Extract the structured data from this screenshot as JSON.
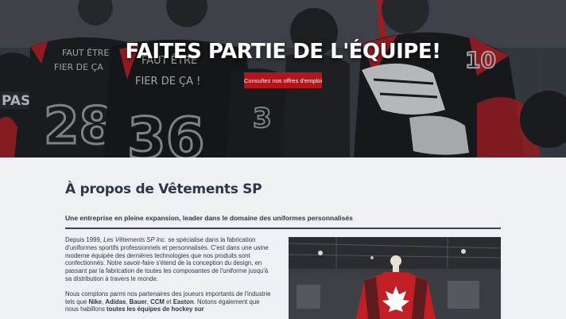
{
  "hero": {
    "title": "FAITES PARTIE DE L'ÉQUIPE!",
    "button_label": "Consultez nos offres d'emploi",
    "jersey_texts": [
      "FAUT ÊTRE",
      "FIER DE ÇA",
      "FAUT ÊTRE",
      "FIER DE ÇA !"
    ],
    "jersey_numbers": [
      "28",
      "36",
      "3",
      "10"
    ]
  },
  "about": {
    "title": "À propos de Vêtements SP",
    "subtitle": "Une entreprise en pleine expansion, leader dans le domaine des uniformes personnalisés",
    "p1_before_em": "Depuis 1999, ",
    "p1_em": "Les Vêtements SP Inc.",
    "p1_after_em": " se spécialise dans la fabrication d'uniformes sportifs professionnels et personnalisés. C'est dans une usine moderne équipée des dernières technologies que nos produits sont confectionnés. Notre savoir-faire s'étend de la conception du design, en passant par la fabrication de toutes les composantes de l'uniforme jusqu'à sa distribution à travers le monde.",
    "p2_start": "Nous comptons parmi nos partenaires des joueurs importants de l'industrie tels que ",
    "brand_1": "Nike",
    "sep_1": ", ",
    "brand_2": "Adidas",
    "sep_2": ", ",
    "brand_3": "Bauer",
    "sep_3": ", ",
    "brand_4": "CCM",
    "sep_4": " et ",
    "brand_5": "Easton",
    "p2_mid": ". Notons également que nous habillons ",
    "p2_strong": "toutes les équipes de hockey sur"
  },
  "colors": {
    "accent_red": "#b4141b",
    "dark_text": "#2f3743",
    "section_bg": "#eef0f3"
  }
}
